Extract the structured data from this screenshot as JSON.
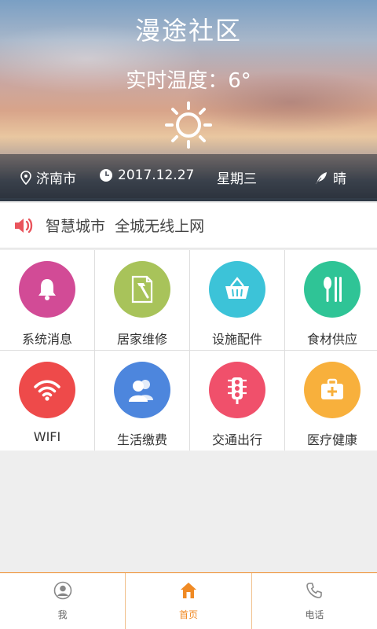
{
  "header": {
    "title": "漫途社区",
    "temperature": "实时温度：6°",
    "weather_icon": "sun-icon",
    "city": "济南市",
    "date": "2017.12.27",
    "weekday": "星期三",
    "weather": "晴"
  },
  "notice": {
    "icon": "speaker-icon",
    "text": "智慧城市  全城无线上网"
  },
  "services": [
    {
      "label": "系统消息",
      "icon": "bell-icon",
      "color": "#d24b96"
    },
    {
      "label": "居家维修",
      "icon": "hammer-document-icon",
      "color": "#a8c35a"
    },
    {
      "label": "设施配件",
      "icon": "basket-icon",
      "color": "#3cc3d8"
    },
    {
      "label": "食材供应",
      "icon": "spoon-chopsticks-icon",
      "color": "#2fc496"
    },
    {
      "label": "WIFI",
      "icon": "wifi-icon",
      "color": "#ee4a4a"
    },
    {
      "label": "生活缴费",
      "icon": "people-icon",
      "color": "#4d86dd"
    },
    {
      "label": "交通出行",
      "icon": "traffic-light-icon",
      "color": "#f0506b"
    },
    {
      "label": "医疗健康",
      "icon": "medical-kit-icon",
      "color": "#f8b03c"
    }
  ],
  "tabbar": {
    "accent": "#f08a24",
    "tabs": [
      {
        "label": "我",
        "icon": "person-icon",
        "active": false
      },
      {
        "label": "首页",
        "icon": "home-icon",
        "active": true
      },
      {
        "label": "电话",
        "icon": "phone-icon",
        "active": false
      }
    ]
  }
}
